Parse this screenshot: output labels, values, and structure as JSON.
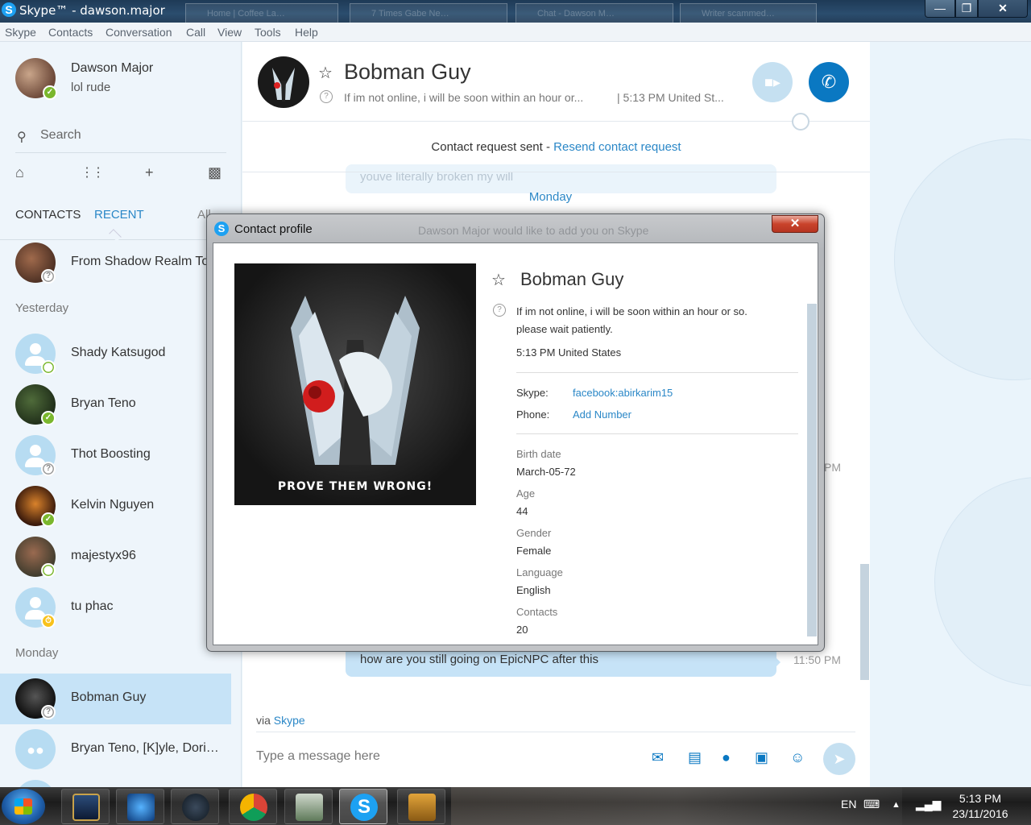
{
  "window": {
    "title": "Skype™ - dawson.major",
    "background_tabs": [
      "Home | Coffee La…",
      "7 Times Gabe Ne…",
      "Chat - Dawson M…",
      "Writer scammed…"
    ],
    "minimize": "—",
    "maximize": "❐",
    "close": "✕"
  },
  "menu": [
    "Skype",
    "Contacts",
    "Conversation",
    "Call",
    "View",
    "Tools",
    "Help"
  ],
  "me": {
    "name": "Dawson Major",
    "mood": "lol rude"
  },
  "search": {
    "placeholder": "Search"
  },
  "tabs": {
    "contacts": "CONTACTS",
    "recent": "RECENT",
    "all": "All"
  },
  "sections": {
    "yesterday": "Yesterday",
    "monday": "Monday"
  },
  "recent_top": {
    "name": "From Shadow Realm To…"
  },
  "contacts_yesterday": [
    {
      "name": "Shady Katsugod"
    },
    {
      "name": "Bryan Teno"
    },
    {
      "name": "Thot Boosting"
    },
    {
      "name": "Kelvin Nguyen"
    },
    {
      "name": "majestyx96"
    },
    {
      "name": "tu phac"
    }
  ],
  "contacts_monday": [
    {
      "name": "Bobman Guy"
    },
    {
      "name": "Bryan Teno, [K]yle, Dori…"
    }
  ],
  "chat": {
    "name": "Bobman Guy",
    "mood": "If im not online, i will be soon within an hour or...",
    "time": "| 5:13 PM United St...",
    "request_text": "Contact request sent - ",
    "request_link": "Resend contact request",
    "faded_message": "youve literally broken my will",
    "day": "Monday",
    "message": "how are you still going on EpicNPC after this",
    "message_time": "11:50 PM",
    "peek_time": "PM",
    "via": "via ",
    "via_link": "Skype",
    "compose_placeholder": "Type a message here"
  },
  "dialog": {
    "title": "Contact profile",
    "ghost_text": "Dawson Major would like to add you on Skype",
    "close": "✕",
    "picture_caption": "PROVE THEM WRONG!",
    "name": "Bobman Guy",
    "mood_line1": "If im not online, i will be soon within an hour or so.",
    "mood_line2": "please wait patiently.",
    "time": "5:13 PM United States",
    "skype_label": "Skype:",
    "skype_value": "facebook:abirkarim15",
    "phone_label": "Phone:",
    "phone_value": "Add Number",
    "fields": [
      {
        "label": "Birth date",
        "value": "March-05-72"
      },
      {
        "label": "Age",
        "value": "44"
      },
      {
        "label": "Gender",
        "value": "Female"
      },
      {
        "label": "Language",
        "value": "English"
      },
      {
        "label": "Contacts",
        "value": "20"
      }
    ]
  },
  "taskbar": {
    "lang": "EN",
    "time": "5:13 PM",
    "date": "23/11/2016",
    "apps": [
      "league-of-legends-icon",
      "battle-net-icon",
      "steam-icon",
      "chrome-icon",
      "system-monitor-icon",
      "skype-icon",
      "csgo-icon"
    ]
  },
  "colors": {
    "accent": "#2a87c7",
    "call_button": "#0a78c2",
    "selected_row": "#c6e3f7",
    "online": "#7ab72d",
    "away": "#f8c21b"
  }
}
